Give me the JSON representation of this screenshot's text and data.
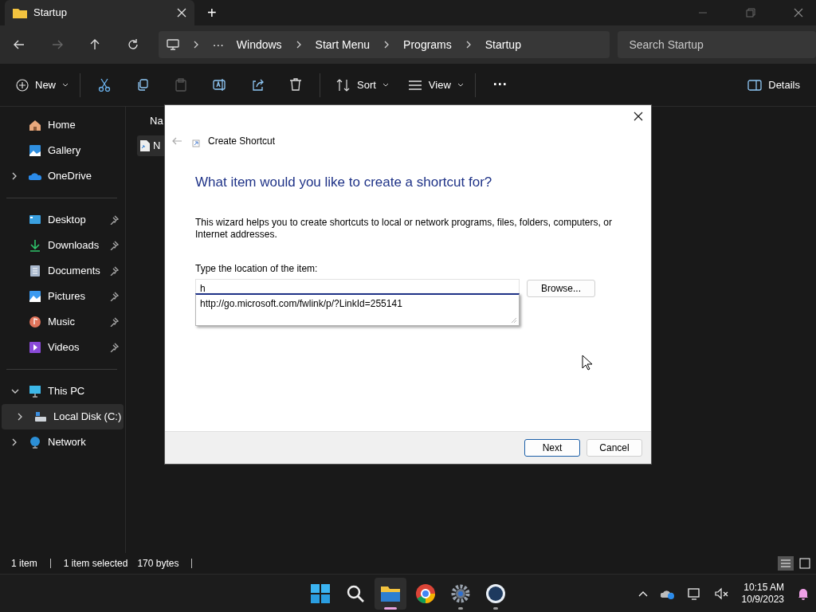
{
  "window": {
    "tab_title": "Startup",
    "new_tab": "+"
  },
  "address": {
    "overflow": "···",
    "breadcrumbs": [
      "Windows",
      "Start Menu",
      "Programs",
      "Startup"
    ],
    "search": {
      "placeholder": "Search Startup"
    }
  },
  "toolbar": {
    "new": "New",
    "icon_buttons": [
      {
        "disabled": false
      },
      {
        "disabled": false
      },
      {
        "disabled": true
      },
      {
        "disabled": false
      },
      {
        "disabled": false
      },
      {
        "disabled": false
      }
    ],
    "sort": "Sort",
    "view": "View",
    "more": "···",
    "details": "Details"
  },
  "sidebar": {
    "sections": [
      [
        {
          "label": "Home",
          "selected": false,
          "pinned": false
        },
        {
          "label": "Gallery",
          "selected": false,
          "pinned": false
        },
        {
          "label": "OneDrive",
          "selected": false,
          "pinned": false,
          "expanded": false
        }
      ],
      [
        {
          "label": "Desktop",
          "selected": false,
          "pinned": true
        },
        {
          "label": "Downloads",
          "selected": false,
          "pinned": true
        },
        {
          "label": "Documents",
          "selected": false,
          "pinned": true
        },
        {
          "label": "Pictures",
          "selected": false,
          "pinned": true
        },
        {
          "label": "Music",
          "selected": false,
          "pinned": true
        },
        {
          "label": "Videos",
          "selected": false,
          "pinned": true
        }
      ],
      [
        {
          "label": "This PC",
          "selected": false,
          "pinned": false,
          "expanded": true,
          "children": [
            {
              "label": "Local Disk (C:)",
              "selected": true,
              "pinned": false,
              "expanded": false
            }
          ]
        },
        {
          "label": "Network",
          "selected": false,
          "pinned": false,
          "expanded": false
        }
      ]
    ]
  },
  "content": {
    "column_header": "Na",
    "files": [
      {
        "name": "N",
        "selected": true
      }
    ]
  },
  "dialog": {
    "title": "Create Shortcut",
    "heading": "What item would you like to create a shortcut for?",
    "description": "This wizard helps you to create shortcuts to local or network programs, files, folders, computers, or Internet addresses.",
    "field_label": "Type the location of the item:",
    "value": "h",
    "suggestions": [
      "http://go.microsoft.com/fwlink/p/?LinkId=255141"
    ],
    "browse": "Browse...",
    "buttons": [
      {
        "label": "Next",
        "default": true
      },
      {
        "label": "Cancel",
        "default": false
      }
    ]
  },
  "status_bar": {
    "count": "1 item",
    "selection": "1 item selected",
    "size": "170 bytes",
    "views": [
      {
        "selected": true
      },
      {
        "selected": false
      }
    ]
  },
  "taskbar": {
    "apps": [
      {
        "active": false,
        "running": false
      },
      {
        "active": false,
        "running": false
      },
      {
        "active": true,
        "running": true
      },
      {
        "active": false,
        "running": false
      },
      {
        "active": false,
        "running": true
      },
      {
        "active": false,
        "running": true
      }
    ],
    "time": "10:15 AM",
    "date": "10/9/2023"
  }
}
